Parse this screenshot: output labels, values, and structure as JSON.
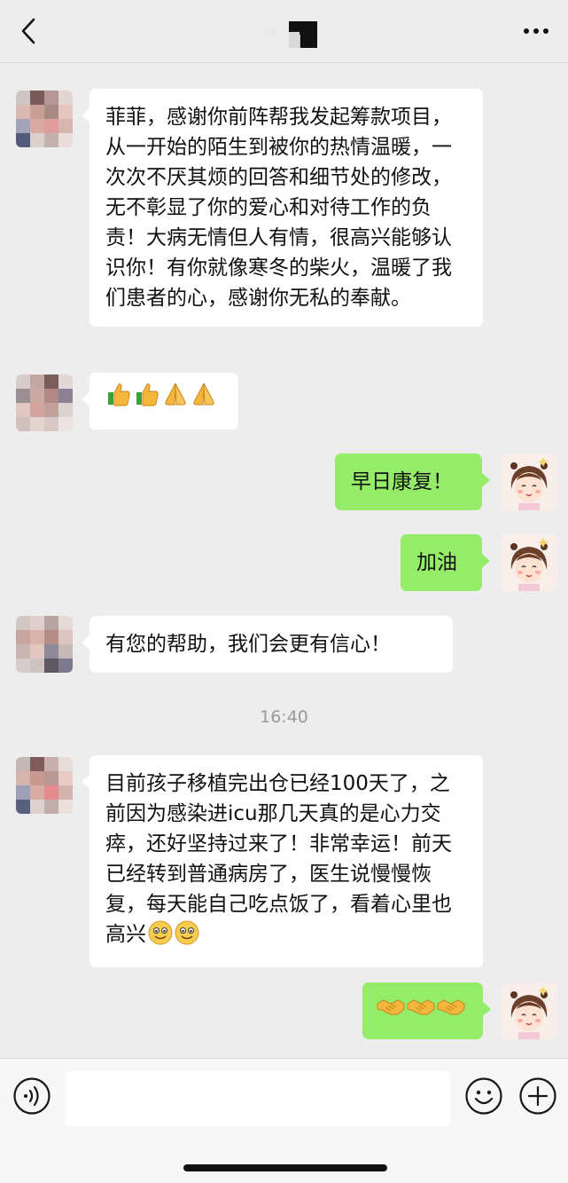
{
  "header": {
    "back_icon": "chevron-left-icon",
    "more_icon": "more-dots-icon"
  },
  "messages": [
    {
      "side": "left",
      "text": "菲菲，感谢你前阵帮我发起筹款项目，从一开始的陌生到被你的热情温暖，一次次不厌其烦的回答和细节处的修改，无不彰显了你的爱心和对待工作的负责！大病无情但人有情，很高兴能够认识你！有你就像寒冬的柴火，温暖了我们患者的心，感谢你无私的奉献。"
    },
    {
      "side": "left",
      "emojis": [
        "thumbs-up",
        "thumbs-up",
        "pray",
        "pray"
      ]
    },
    {
      "side": "right",
      "text": "早日康复！"
    },
    {
      "side": "right",
      "text": "加油"
    },
    {
      "side": "left",
      "text": "有您的帮助，我们会更有信心！"
    },
    {
      "side": "left",
      "text": "目前孩子移植完出仓已经100天了，之前因为感染进icu那几天真的是心力交瘁，还好坚持过来了！非常幸运！前天已经转到普通病房了，医生说慢慢恢复，每天能自己吃点饭了，看着心里也高兴",
      "emojis": [
        "smile",
        "smile"
      ]
    },
    {
      "side": "right",
      "emojis": [
        "handshake",
        "handshake",
        "handshake"
      ]
    }
  ],
  "timestamp": "16:40",
  "input": {
    "placeholder": ""
  },
  "colors": {
    "bubble_right": "#95ec69",
    "bubble_left": "#ffffff",
    "background": "#ededed"
  }
}
